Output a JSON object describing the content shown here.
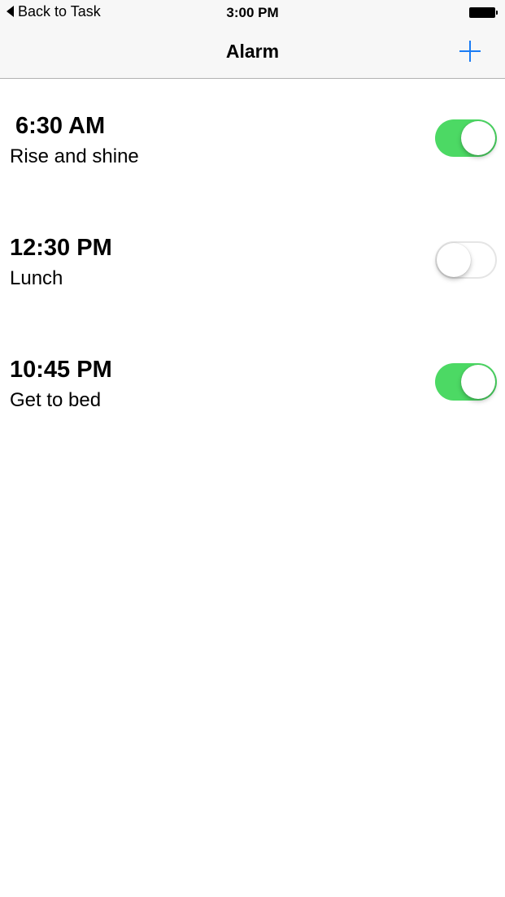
{
  "status_bar": {
    "back_label": "Back to Task",
    "time": "3:00 PM",
    "battery_icon": "battery-full-icon"
  },
  "nav_bar": {
    "title": "Alarm",
    "add_icon": "plus-icon",
    "accent_color": "#1a7cf5"
  },
  "alarms": [
    {
      "time": "6:30 AM",
      "label": "Rise and shine",
      "enabled": true
    },
    {
      "time": "12:30 PM",
      "label": "Lunch",
      "enabled": false
    },
    {
      "time": "10:45 PM",
      "label": "Get to bed",
      "enabled": true
    }
  ],
  "colors": {
    "toggle_on": "#4cd964",
    "toggle_off_border": "#e5e5e5",
    "bar_background": "#f7f7f7"
  }
}
